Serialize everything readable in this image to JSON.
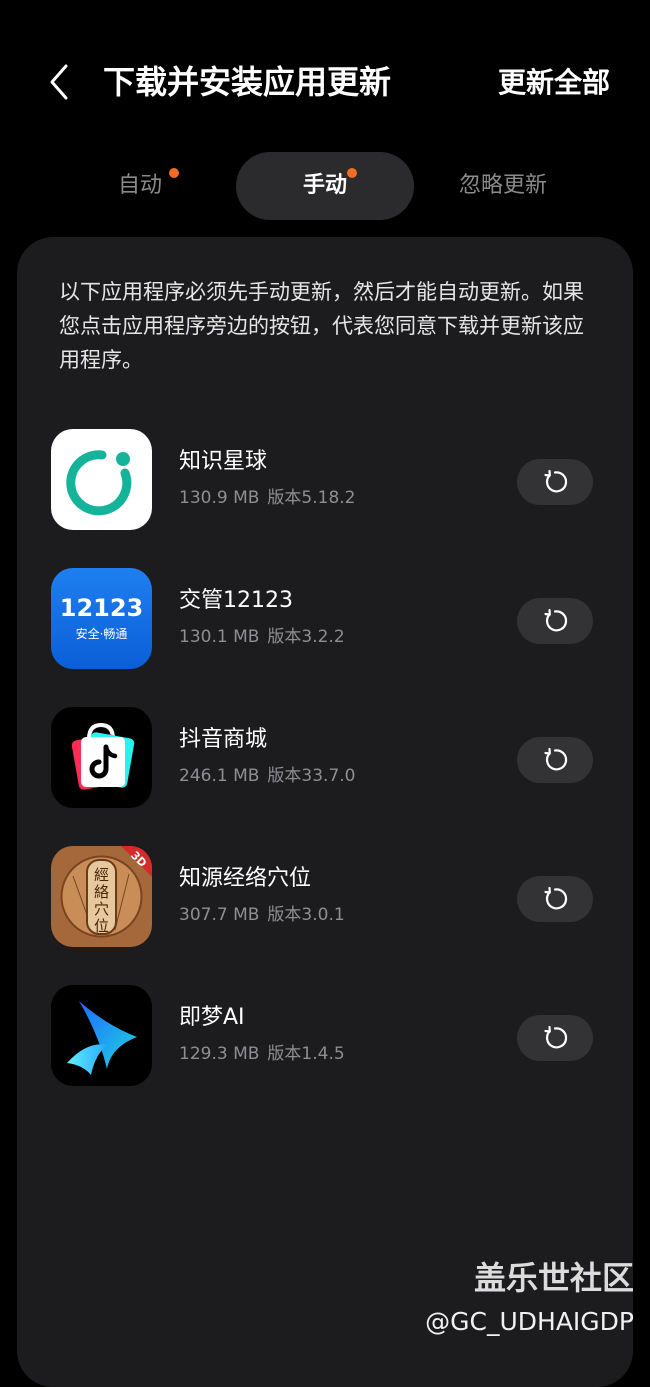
{
  "header": {
    "title": "下载并安装应用更新",
    "update_all_label": "更新全部"
  },
  "tabs": [
    {
      "label": "自动",
      "has_dot": true
    },
    {
      "label": "手动",
      "has_dot": true,
      "selected": true
    },
    {
      "label": "忽略更新",
      "has_dot": false
    }
  ],
  "notice": "以下应用程序必须先手动更新，然后才能自动更新。如果您点击应用程序旁边的按钮，代表您同意下载并更新该应用程序。",
  "apps": [
    {
      "name": "知识星球",
      "size": "130.9 MB",
      "version": "版本5.18.2",
      "icon": "zsxq-icon"
    },
    {
      "name": "交管12123",
      "size": "130.1 MB",
      "version": "版本3.2.2",
      "icon": "jiaoguan-12123-icon",
      "icon_text": "12123",
      "icon_subtext": "安全·畅通"
    },
    {
      "name": "抖音商城",
      "size": "246.1 MB",
      "version": "版本33.7.0",
      "icon": "douyin-mall-icon"
    },
    {
      "name": "知源经络穴位",
      "size": "307.7 MB",
      "version": "版本3.0.1",
      "icon": "zhiyuan-acupoint-icon",
      "icon_text": "經絡穴位",
      "icon_badge": "3D"
    },
    {
      "name": "即梦AI",
      "size": "129.3 MB",
      "version": "版本1.4.5",
      "icon": "jimeng-ai-icon"
    }
  ],
  "watermark": {
    "brand": "盖乐世社区",
    "user": "@GC_UDHAIGDP"
  },
  "colors": {
    "background": "#000000",
    "card": "#1c1c1e",
    "tab_selected": "#2b2b2e",
    "dot": "#f36c21",
    "update_button": "#333336",
    "secondary_text": "#8e8e93"
  }
}
